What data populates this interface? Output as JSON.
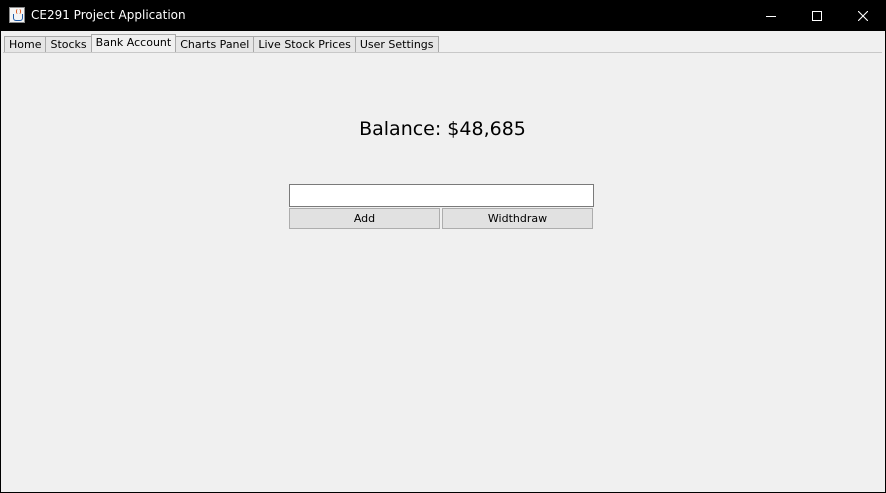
{
  "window": {
    "title": "CE291 Project Application",
    "controls": {
      "minimize_icon": "minimize-icon",
      "maximize_icon": "maximize-icon",
      "close_icon": "close-icon"
    }
  },
  "tabs": [
    {
      "label": "Home",
      "active": false
    },
    {
      "label": "Stocks",
      "active": false
    },
    {
      "label": "Bank Account",
      "active": true
    },
    {
      "label": "Charts Panel",
      "active": false
    },
    {
      "label": "Live Stock Prices",
      "active": false
    },
    {
      "label": "User Settings",
      "active": false
    }
  ],
  "bank": {
    "balance_text": "Balance: $48,685",
    "amount_value": "",
    "amount_placeholder": "",
    "add_label": "Add",
    "withdraw_label": "Widthdraw"
  },
  "colors": {
    "titlebar": "#000000",
    "panel_background": "#f0f0f0",
    "button_face": "#e1e1e1"
  }
}
